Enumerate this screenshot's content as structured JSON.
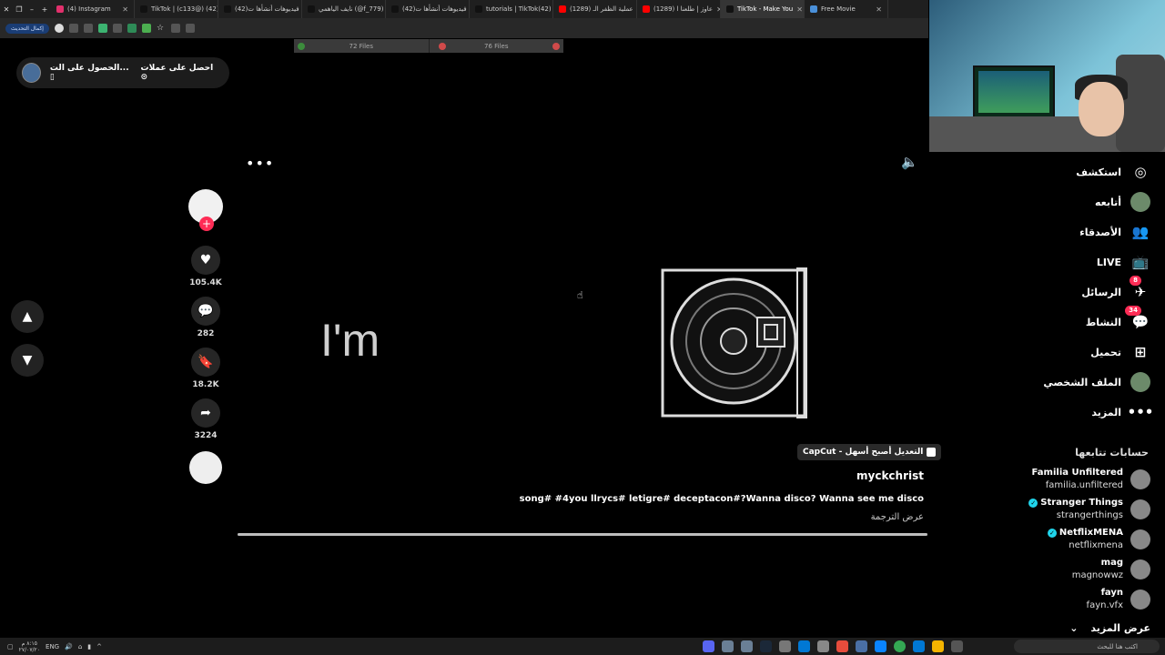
{
  "browser": {
    "tabs": [
      {
        "title": "(4) Instagram",
        "color": "#e1306c"
      },
      {
        "title": "TikTok | (c133@) (42)",
        "color": "#111111"
      },
      {
        "title": "(42)فيديوهات أنشأها ت",
        "color": "#111111"
      },
      {
        "title": "نايف الياهمي (@f_779)",
        "color": "#111111"
      },
      {
        "title": "(42)فيديوهات أنشأها ت",
        "color": "#111111"
      },
      {
        "title": "tutorials | TikTok(42)",
        "color": "#111111"
      },
      {
        "title": "(1289) عملية الظفر الـ",
        "color": "#ff0000"
      },
      {
        "title": "(1289) عاوز | طلعنا ا",
        "color": "#ff0000"
      },
      {
        "title": "TikTok - Make You",
        "color": "#111111"
      },
      {
        "title": "Free Movie",
        "color": "#4a90d9"
      }
    ],
    "update_label": "إكمال التحديث"
  },
  "file_bar": {
    "left": "72 Files",
    "right": "76 Files"
  },
  "promo": {
    "item1": "احصل على عملات",
    "item2": "الحصول على الت..."
  },
  "overlay": {
    "more_dots": "•••",
    "caption_text": "I'm"
  },
  "actions": {
    "likes": "105.4K",
    "comments": "282",
    "saves": "18.2K",
    "shares": "3224"
  },
  "video": {
    "effect_label": "CapCut - التعديل أصبح أسهل",
    "author": "myckchrist",
    "description": "song# #4you llrycs# letigre# deceptacon#?Wanna disco? Wanna see me disco",
    "translate": "عرض الترجمة",
    "progress": 1.0
  },
  "sidebar": {
    "items": [
      {
        "label": "استكشف",
        "icon": "compass-icon",
        "glyph": "◎",
        "badge": ""
      },
      {
        "label": "أتابعه",
        "icon": "following-avatar",
        "glyph": "",
        "badge": ""
      },
      {
        "label": "الأصدقاء",
        "icon": "friends-icon",
        "glyph": "👥",
        "badge": ""
      },
      {
        "label": "LIVE",
        "icon": "live-icon",
        "glyph": "📺",
        "badge": ""
      },
      {
        "label": "الرسائل",
        "icon": "messages-icon",
        "glyph": "✈",
        "badge": "8"
      },
      {
        "label": "النشاط",
        "icon": "activity-icon",
        "glyph": "💬",
        "badge": "34"
      },
      {
        "label": "تحميل",
        "icon": "upload-icon",
        "glyph": "⊞",
        "badge": ""
      },
      {
        "label": "الملف الشخصي",
        "icon": "profile-avatar",
        "glyph": "",
        "badge": ""
      },
      {
        "label": "المزيد",
        "icon": "more-icon",
        "glyph": "•••",
        "badge": ""
      }
    ],
    "following_header": "حسابات تتابعها",
    "accounts": [
      {
        "name": "Familia Unfiltered",
        "handle": "familia.unfiltered",
        "verified": false
      },
      {
        "name": "Stranger Things",
        "handle": "strangerthings",
        "verified": true
      },
      {
        "name": "NetflixMENA",
        "handle": "netflixmena",
        "verified": true
      },
      {
        "name": "mag",
        "handle": "magnowwz",
        "verified": false
      },
      {
        "name": "fayn",
        "handle": "fayn.vfx",
        "verified": false
      }
    ],
    "see_more": "عرض المزيد"
  },
  "taskbar": {
    "time": "٨:١٥ م",
    "date": "٢٧/٠٧/٢٠",
    "lang": "ENG",
    "search_placeholder": "اكتب هنا للبحث"
  },
  "colors": {
    "accent": "#fe2c55",
    "verified": "#20d5ec"
  }
}
